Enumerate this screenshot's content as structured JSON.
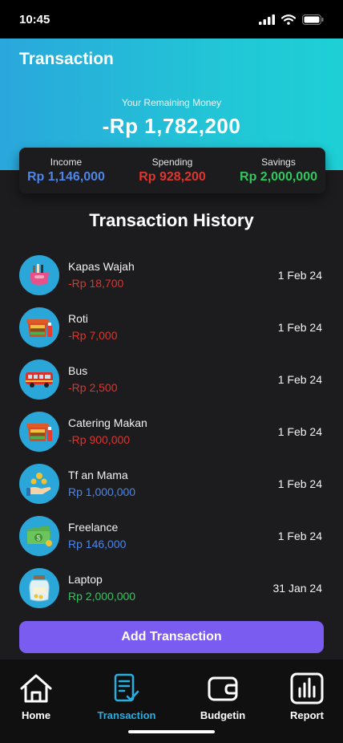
{
  "status_bar": {
    "time": "10:45"
  },
  "header": {
    "title": "Transaction",
    "remaining_label": "Your Remaining Money",
    "remaining_value": "-Rp 1,782,200"
  },
  "summary": {
    "income_label": "Income",
    "income_value": "Rp 1,146,000",
    "spending_label": "Spending",
    "spending_value": "Rp 928,200",
    "savings_label": "Savings",
    "savings_value": "Rp 2,000,000"
  },
  "history": {
    "title": "Transaction History",
    "items": [
      {
        "name": "Kapas Wajah",
        "amount": "-Rp 18,700",
        "date": "1 Feb 24",
        "type": "expense",
        "icon": "cosmetics-bag-icon"
      },
      {
        "name": "Roti",
        "amount": "-Rp 7,000",
        "date": "1 Feb 24",
        "type": "expense",
        "icon": "food-icon"
      },
      {
        "name": "Bus",
        "amount": "-Rp 2,500",
        "date": "1 Feb 24",
        "type": "expense",
        "icon": "bus-icon"
      },
      {
        "name": "Catering Makan",
        "amount": "-Rp 900,000",
        "date": "1 Feb 24",
        "type": "expense",
        "icon": "food-icon"
      },
      {
        "name": "Tf an Mama",
        "amount": "Rp 1,000,000",
        "date": "1 Feb 24",
        "type": "income",
        "icon": "hand-coins-icon"
      },
      {
        "name": "Freelance",
        "amount": "Rp 146,000",
        "date": "1 Feb 24",
        "type": "income",
        "icon": "money-bill-icon"
      },
      {
        "name": "Laptop",
        "amount": "Rp 2,000,000",
        "date": "31 Jan 24",
        "type": "savings",
        "icon": "savings-jar-icon"
      }
    ]
  },
  "add_button_label": "Add Transaction",
  "tabs": {
    "home": "Home",
    "transaction": "Transaction",
    "budgetin": "Budgetin",
    "report": "Report"
  },
  "colors": {
    "header_start": "#2aa7dc",
    "header_end": "#1ed0d6",
    "income": "#4b86e8",
    "expense": "#e0342c",
    "savings": "#2ec95c",
    "accent": "#7b5cf0",
    "active_tab": "#29aee0"
  }
}
